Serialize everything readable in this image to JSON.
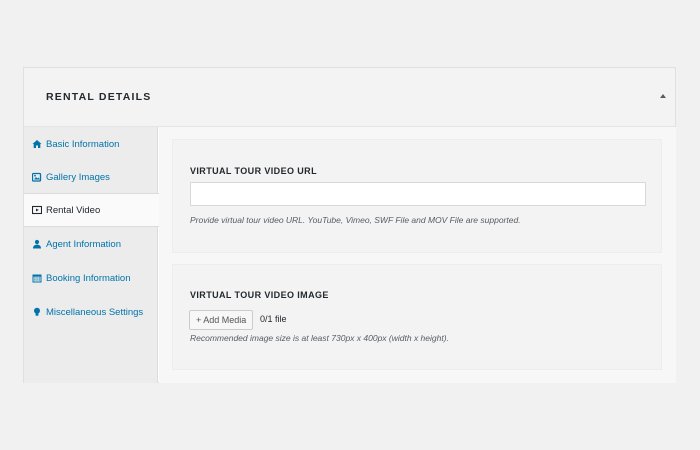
{
  "metabox": {
    "title": "RENTAL DETAILS"
  },
  "tabs": [
    {
      "label": "Basic Information",
      "icon": "home-icon",
      "active": false
    },
    {
      "label": "Gallery Images",
      "icon": "gallery-icon",
      "active": false
    },
    {
      "label": "Rental Video",
      "icon": "video-icon",
      "active": true
    },
    {
      "label": "Agent Information",
      "icon": "user-icon",
      "active": false
    },
    {
      "label": "Booking Information",
      "icon": "calendar-icon",
      "active": false
    },
    {
      "label": "Miscellaneous Settings",
      "icon": "lightbulb-icon",
      "active": false
    }
  ],
  "video_url": {
    "label": "VIRTUAL TOUR VIDEO URL",
    "value": "",
    "placeholder": "",
    "help": "Provide virtual tour video URL. YouTube, Vimeo, SWF File and MOV File are supported."
  },
  "video_image": {
    "label": "VIRTUAL TOUR VIDEO IMAGE",
    "button_label": "+ Add Media",
    "file_count": "0/1 file",
    "help": "Recommended image size is at least 730px x 400px (width x height)."
  },
  "colors": {
    "link": "#0073aa",
    "text": "#23282d",
    "background": "#f1f1f1"
  }
}
